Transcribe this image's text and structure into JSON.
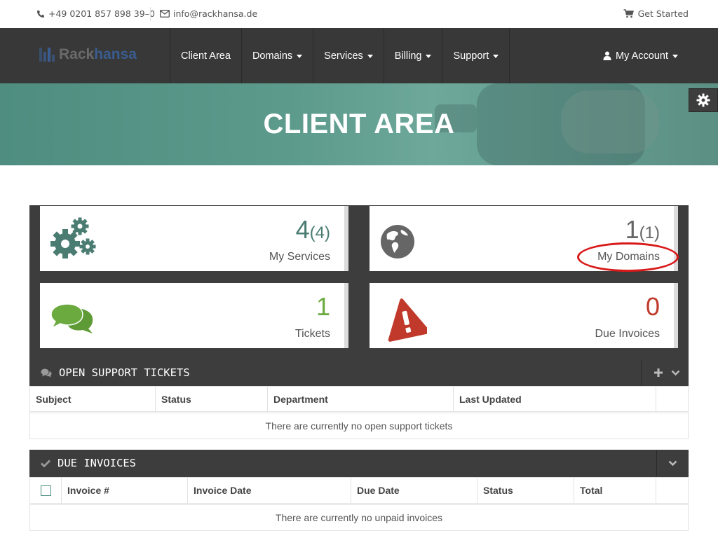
{
  "topbar": {
    "phone": "+49 0201 857 898 39–0",
    "email": "info@rackhansa.de",
    "get_started": "Get Started"
  },
  "brand": {
    "part1": "Rack",
    "part2": "hansa"
  },
  "nav": {
    "items": [
      {
        "label": "Client Area",
        "dropdown": false
      },
      {
        "label": "Domains",
        "dropdown": true
      },
      {
        "label": "Services",
        "dropdown": true
      },
      {
        "label": "Billing",
        "dropdown": true
      },
      {
        "label": "Support",
        "dropdown": true
      }
    ],
    "account": "My Account"
  },
  "hero": {
    "title": "CLIENT AREA"
  },
  "tiles": [
    {
      "count": "4",
      "total": "(4)",
      "label": "My Services",
      "icon": "gears-icon",
      "color": "#4a7c72"
    },
    {
      "count": "1",
      "total": "(1)",
      "label": "My Domains",
      "icon": "globe-icon",
      "color": "#666666"
    },
    {
      "count": "1",
      "total": "",
      "label": "Tickets",
      "icon": "chat-bubbles-icon",
      "color": "#6aaa3e"
    },
    {
      "count": "0",
      "total": "",
      "label": "Due Invoices",
      "icon": "warning-icon",
      "color": "#c0392b"
    }
  ],
  "tickets": {
    "title": "OPEN SUPPORT TICKETS",
    "columns": [
      "Subject",
      "Status",
      "Department",
      "Last Updated"
    ],
    "empty": "There are currently no open support tickets"
  },
  "invoices": {
    "title": "DUE INVOICES",
    "columns": [
      "Invoice #",
      "Invoice Date",
      "Due Date",
      "Status",
      "Total"
    ],
    "empty": "There are currently no unpaid invoices"
  },
  "colors": {
    "nav": "#383838",
    "accent": "#4a7c72",
    "highlight": "#d81919"
  }
}
